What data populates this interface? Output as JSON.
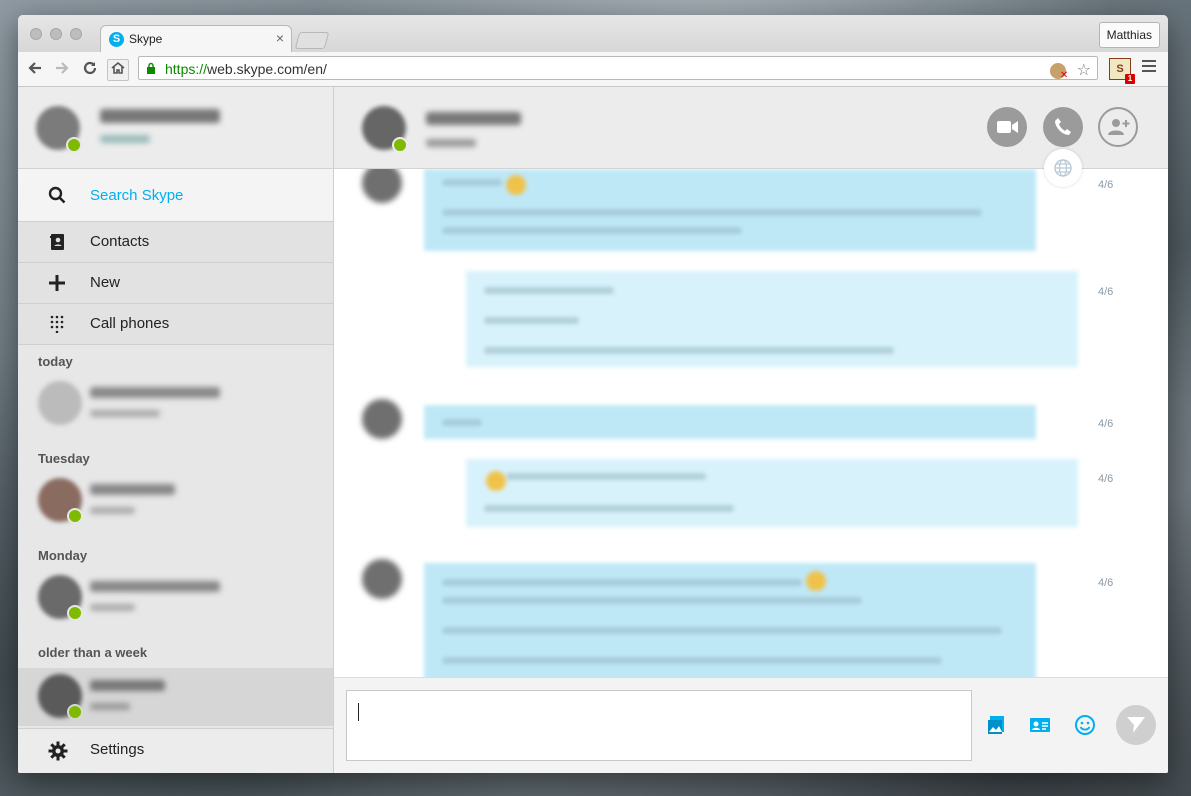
{
  "browser": {
    "tab_title": "Skype",
    "tab_favicon_letter": "S",
    "profile_name": "Matthias",
    "url_scheme": "https://",
    "url_rest": "web.skype.com/en/",
    "extension_badge": "1"
  },
  "sidebar": {
    "search_label": "Search Skype",
    "items": [
      {
        "label": "Contacts",
        "icon": "contacts-book-icon"
      },
      {
        "label": "New",
        "icon": "plus-icon"
      },
      {
        "label": "Call phones",
        "icon": "dialpad-icon"
      }
    ],
    "groups": {
      "today": "today",
      "tuesday": "Tuesday",
      "monday": "Monday",
      "older": "older than a week"
    },
    "settings_label": "Settings"
  },
  "chat": {
    "timestamps": [
      "4/6",
      "4/6",
      "4/6",
      "4/6",
      "4/6"
    ]
  },
  "colors": {
    "accent": "#00aff0",
    "presence_online": "#7fba00",
    "bubble_incoming": "#bfe8f7",
    "bubble_outgoing": "#d8f2fb"
  }
}
